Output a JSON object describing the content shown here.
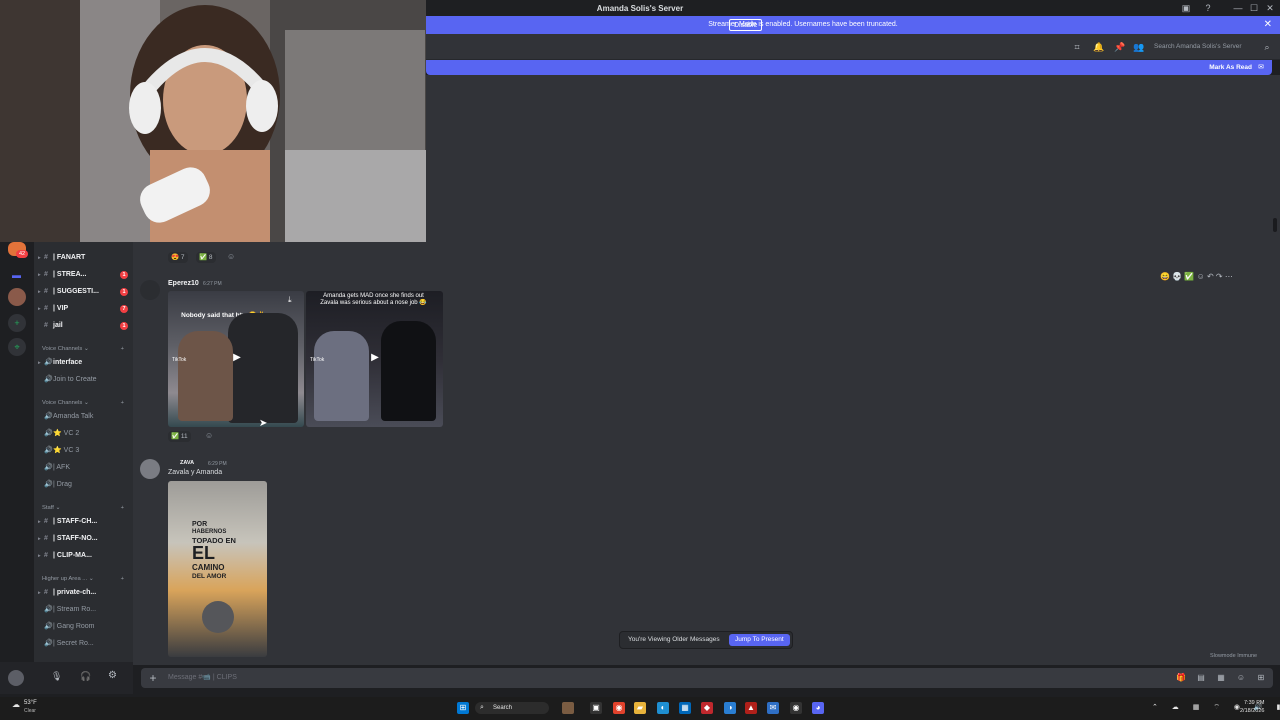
{
  "window": {
    "title": "Amanda Solis's Server"
  },
  "banner": {
    "text": "Streamer Mode is enabled. Usernames have been truncated.",
    "button": "Disable"
  },
  "header": {
    "search_placeholder": "Search Amanda Solis's Server"
  },
  "unread_bar": {
    "label": "Mark As Read"
  },
  "channels": [
    {
      "name": "| FANART",
      "badge": ""
    },
    {
      "name": "| STREA...",
      "badge": "1"
    },
    {
      "name": "| SUGGESTI...",
      "badge": "1"
    },
    {
      "name": "| VIP",
      "badge": "7"
    },
    {
      "name": "jail",
      "badge": "1"
    }
  ],
  "voice_categories": [
    {
      "label": "Voice Channels",
      "items": [
        "interface",
        "Join to Create"
      ]
    },
    {
      "label": "Voice Channels",
      "items": [
        "Amanda Talk",
        "VC 2",
        "VC 3",
        "| AFK",
        "| Drag"
      ]
    }
  ],
  "staff_category": {
    "label": "Staff",
    "items": [
      "| STAFF-CH...",
      "| STAFF-NO...",
      "| CLIP-MA..."
    ]
  },
  "higher_up_category": {
    "label": "Higher up Area ...",
    "items": [
      "| private-ch...",
      "| Stream Ro...",
      "| Gang Room",
      "| Secret Ro..."
    ]
  },
  "server_badge": "42",
  "messages": {
    "first_reactions": [
      {
        "emoji": "😍",
        "count": "7"
      },
      {
        "emoji": "✅",
        "count": "8"
      }
    ],
    "eperez": {
      "author": "Eperez10",
      "time": "6:27 PM",
      "video1_caption": "Nobody said that btw 😭✌",
      "video2_caption": "Amanda gets MAD once she finds out Zavala was serious about a nose job 😂",
      "reaction_count": "11",
      "tiktok_label": "TikTok"
    },
    "zava": {
      "author": "ZAVA",
      "time": "6:29 PM",
      "text": "Zavala y Amanda",
      "image_lines": [
        "POR",
        "HABERNOS",
        "TOPADO EN",
        "EL",
        "CAMINO",
        "DEL AMOR"
      ]
    }
  },
  "older_messages": {
    "text": "You're Viewing Older Messages",
    "button": "Jump To Present"
  },
  "composer": {
    "placeholder": "Message #📹 | CLIPS"
  },
  "slowmode": "Slowmode Immune",
  "taskbar": {
    "weather": "53°F",
    "weather_sub": "Clear",
    "search": "Search",
    "time": "7:39 PM",
    "date": "2/18/2026"
  },
  "colors": {
    "blurple": "#5865f2",
    "chat_bg": "#313338",
    "sidebar_bg": "#2b2d31",
    "red_badge": "#f23f43"
  }
}
